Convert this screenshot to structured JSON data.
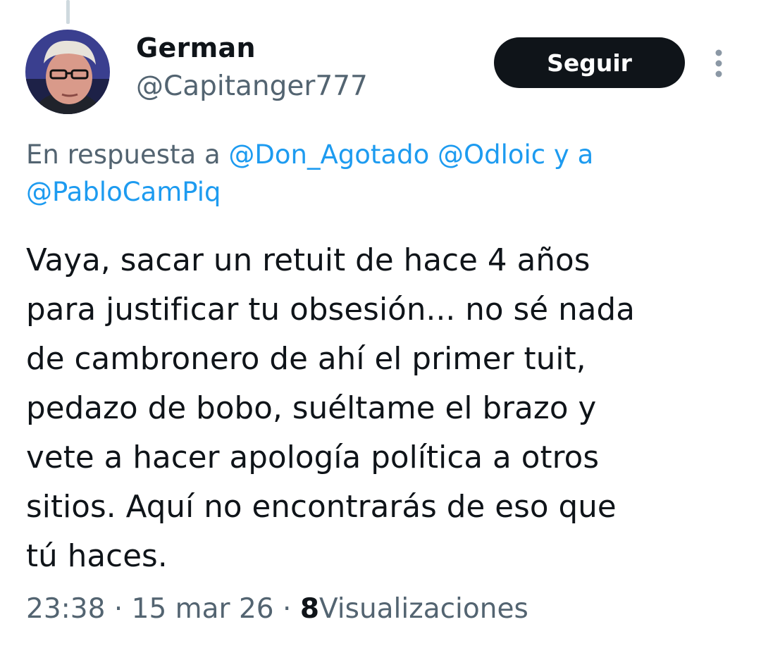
{
  "tweet": {
    "author": {
      "display_name": "German",
      "handle": "@Capitanger777"
    },
    "follow_label": "Seguir",
    "more_icon": "more-vertical-icon",
    "reply_context": {
      "prefix": "En respuesta a",
      "mentions": [
        "@Don_Agotado",
        "@Odloic",
        "@PabloCamPiq"
      ],
      "conjunction": "y a"
    },
    "text_lines": [
      "Vaya, sacar un retuit de hace 4 años",
      "para justificar tu obsesión... no sé nada",
      "de cambronero de ahí el primer tuit,",
      "pedazo de bobo, suéltame el brazo y",
      "vete a hacer apología política a otros",
      "sitios. Aquí no encontrarás de eso que",
      "tú haces."
    ],
    "time": "23:38",
    "separator": "·",
    "date": "15 mar 26",
    "views_count": "8",
    "views_label": "Visualizaciones"
  },
  "colors": {
    "text_primary": "#0f1419",
    "text_secondary": "#536471",
    "link": "#1d9bf0",
    "button_bg": "#0f1419",
    "button_text": "#ffffff"
  }
}
